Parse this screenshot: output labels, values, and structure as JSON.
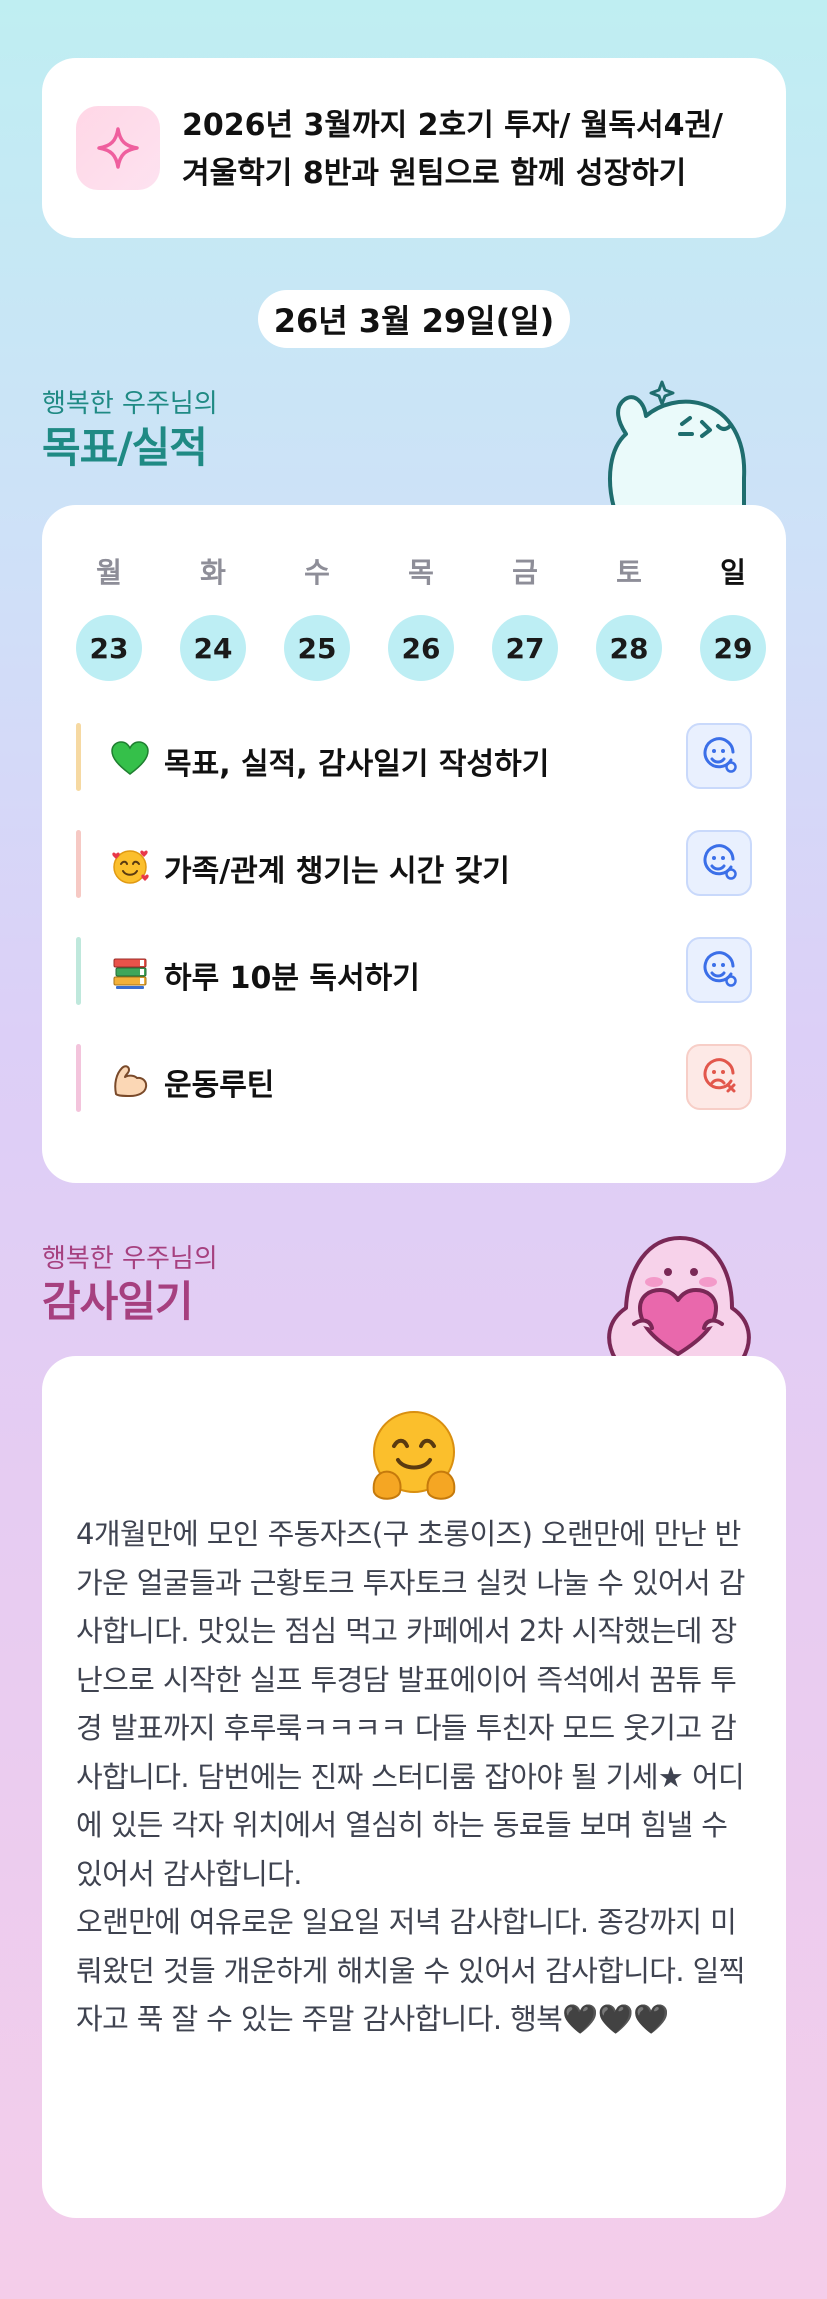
{
  "goal": {
    "line1": "2026년 3월까지 2호기 투자/ 월독서4권/",
    "line2": "겨울학기 8반과 원팀으로 함께 성장하기",
    "icon": "sparkle-icon"
  },
  "date_label": "26년 3월 29일(일)",
  "goals_section": {
    "subtitle": "행복한 우주님의",
    "title": "목표/실적"
  },
  "week": {
    "days": [
      {
        "name": "월",
        "num": "23"
      },
      {
        "name": "화",
        "num": "24"
      },
      {
        "name": "수",
        "num": "25"
      },
      {
        "name": "목",
        "num": "26"
      },
      {
        "name": "금",
        "num": "27"
      },
      {
        "name": "토",
        "num": "28"
      },
      {
        "name": "일",
        "num": "29"
      }
    ]
  },
  "tasks": [
    {
      "label": "목표, 실적, 감사일기 작성하기",
      "icon": "green-heart-icon",
      "status": "done",
      "bar_color": "#f6d9a2"
    },
    {
      "label": "가족/관계 챙기는 시간 갖기",
      "icon": "smiling-face-hearts-icon",
      "status": "done",
      "bar_color": "#f6c9c4"
    },
    {
      "label": "하루 10분 독서하기",
      "icon": "books-icon",
      "status": "done",
      "bar_color": "#bfe8dc"
    },
    {
      "label": "운동루틴",
      "icon": "flexed-biceps-icon",
      "status": "not-done",
      "bar_color": "#f3c4dc"
    }
  ],
  "diary_section": {
    "subtitle": "행복한 우주님의",
    "title": "감사일기"
  },
  "diary": {
    "emoji": "hugging-face-icon",
    "text": "4개월만에 모인 주동자즈(구 초롱이즈) 오랜만에 만난 반가운 얼굴들과 근황토크 투자토크 실컷 나눌 수 있어서 감사합니다. 맛있는 점심 먹고 카페에서 2차 시작했는데 장난으로 시작한 실프 투경담 발표에이어 즉석에서 꿈튜 투경 발표까지 후루룩ㅋㅋㅋㅋ 다들 투친자 모드 웃기고 감사합니다. 담번에는 진짜 스터디룸 잡아야 될 기세★ 어디에 있든 각자 위치에서 열심히 하는 동료들 보며 힘낼 수 있어서 감사합니다.\n오랜만에 여유로운 일요일 저녁 감사합니다. 종강까지 미뤄왔던 것들 개운하게 해치울 수 있어서 감사합니다. 일찍 자고 푹 잘 수 있는 주말 감사합니다. 행복🖤🖤🖤"
  },
  "colors": {
    "goals_title": "#1f8a84",
    "diary_title": "#a6407f",
    "status_ok": "#3b6fe8",
    "status_fail": "#e2574c"
  }
}
